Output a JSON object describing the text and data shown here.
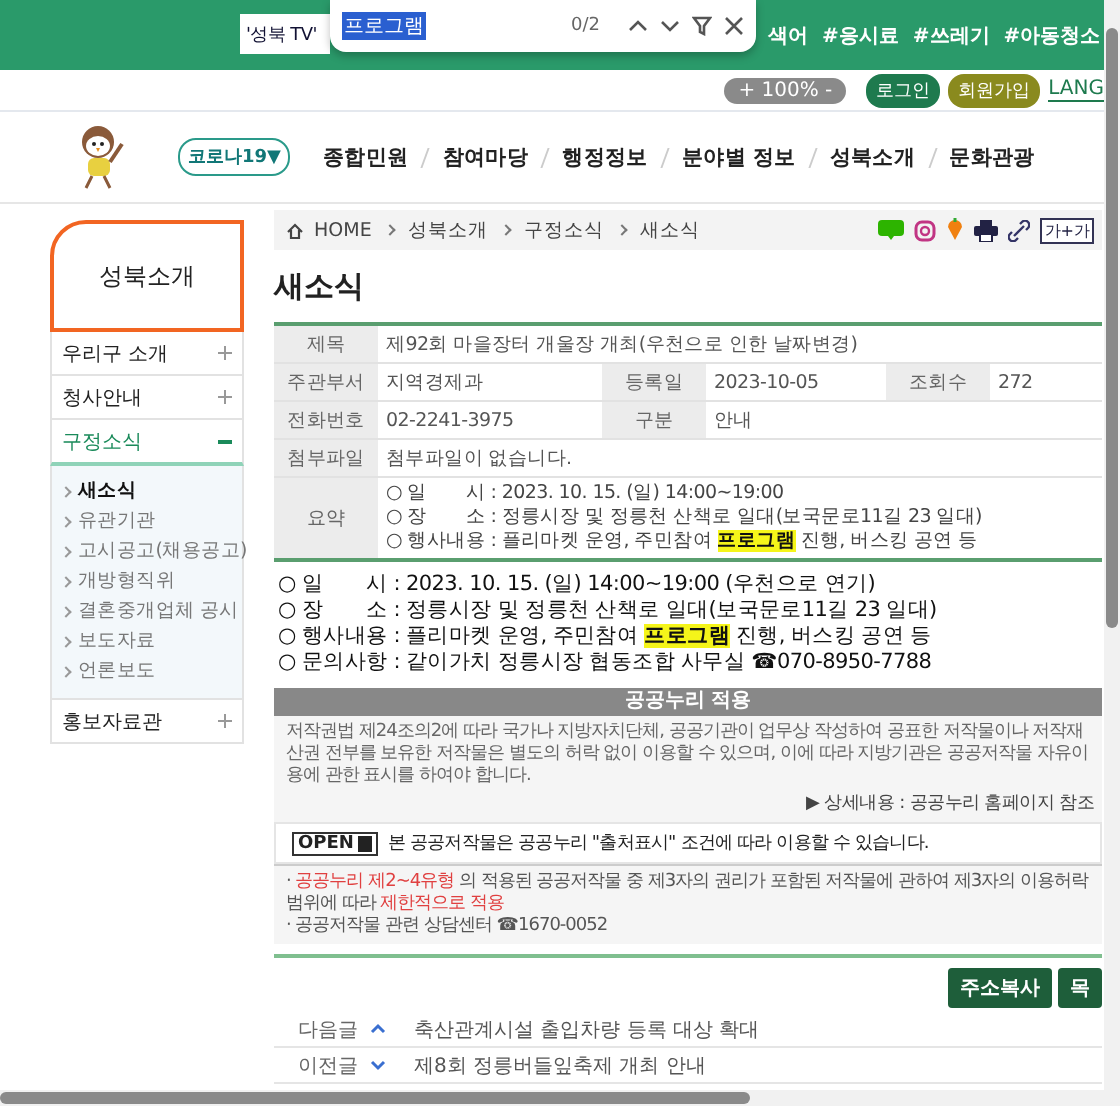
{
  "find_bar": {
    "search_value": "'성북 TV'",
    "find_value": "프로그램",
    "match_count": "0/2"
  },
  "hashtags": [
    "색어",
    "#응시료",
    "#쓰레기",
    "#아동청소"
  ],
  "zoom_control": "+ 100% -",
  "login_button": "로그인",
  "signup_button": "회원가입",
  "language_link": "LANG",
  "covid_button": "코로나19▼",
  "main_menu": [
    "종합민원",
    "참여마당",
    "행정정보",
    "분야별 정보",
    "성북소개",
    "문화관광"
  ],
  "sidebar": {
    "title": "성북소개",
    "items": [
      {
        "label": "우리구 소개",
        "expanded": false
      },
      {
        "label": "청사안내",
        "expanded": false
      },
      {
        "label": "구정소식",
        "expanded": true,
        "children": [
          {
            "label": "새소식",
            "selected": true
          },
          {
            "label": "유관기관",
            "selected": false
          },
          {
            "label": "고시공고(채용공고)",
            "selected": false
          },
          {
            "label": "개방형직위",
            "selected": false
          },
          {
            "label": "결혼중개업체 공시",
            "selected": false
          },
          {
            "label": "보도자료",
            "selected": false
          },
          {
            "label": "언론보도",
            "selected": false
          }
        ]
      },
      {
        "label": "홍보자료관",
        "expanded": false
      }
    ]
  },
  "breadcrumb": [
    "HOME",
    "성북소개",
    "구정소식",
    "새소식"
  ],
  "font_size_button": "가+가",
  "page_title": "새소식",
  "info_table": {
    "rows": [
      [
        {
          "kind": "head",
          "text": "제목"
        },
        {
          "kind": "data",
          "text": "제92회 마을장터 개울장 개최(우천으로 인한 날짜변경)",
          "colspan": 5
        }
      ],
      [
        {
          "kind": "head",
          "text": "주관부서"
        },
        {
          "kind": "data",
          "text": "지역경제과"
        },
        {
          "kind": "head",
          "text": "등록일"
        },
        {
          "kind": "data",
          "text": "2023-10-05"
        },
        {
          "kind": "head",
          "text": "조회수"
        },
        {
          "kind": "data",
          "text": "272"
        }
      ],
      [
        {
          "kind": "head",
          "text": "전화번호"
        },
        {
          "kind": "data",
          "text": "02-2241-3975"
        },
        {
          "kind": "head",
          "text": "구분"
        },
        {
          "kind": "data",
          "text": "안내",
          "colspan": 3
        }
      ],
      [
        {
          "kind": "head",
          "text": "첨부파일"
        },
        {
          "kind": "data",
          "text": "첨부파일이 없습니다.",
          "colspan": 5
        }
      ]
    ]
  },
  "summary": {
    "label": "요약",
    "lines": [
      "○ 일　　시 : 2023. 10. 15. (일) 14:00~19:00",
      "○ 장　　소 : 정릉시장 및 정릉천 산책로 일대(보국문로11길 23 일대)",
      "○ 행사내용 : 플리마켓 운영, 주민참여 **프로그램** 진행, 버스킹 공연 등"
    ]
  },
  "body_lines": [
    "○ 일　　시 : 2023. 10. 15. (일) 14:00~19:00 (우천으로 연기)",
    "○ 장　　소 : 정릉시장 및 정릉천 산책로 일대(보국문로11길 23 일대)",
    "○ 행사내용 : 플리마켓 운영, 주민참여 **프로그램** 진행, 버스킹 공연 등",
    "○ 문의사항 : 같이가치 정릉시장 협동조합 사무실 ☎070-8950-7788"
  ],
  "kogl": {
    "title": "공공누리 적용",
    "description": "저작권법 제24조의2에 따라 국가나 지방자치단체, 공공기관이 업무상 작성하여 공표한 저작물이나 저작재산권 전부를 보유한 저작물은 별도의 허락 없이 이용할 수 있으며, 이에 따라 지방기관은 공공저작물 자유이용에 관한 표시를 하여야 합니다.",
    "detail_link": "▶ 상세내용 : 공공누리 홈페이지 참조",
    "open_badge": "OPEN",
    "license_text": "본 공공저작물은 공공누리 \"출처표시\" 조건에 따라 이용할 수 있습니다.",
    "notices": [
      "· **공공누리 제2~4유형** 의 적용된 공공저작물 중 제3자의 권리가 포함된 저작물에 관하여 제3자의 이용허락 범위에 따라 **제한적으로 적용**",
      "· 공공저작물 관련 상담센터 ☎1670-0052"
    ]
  },
  "buttons": [
    "주소복사",
    "목"
  ],
  "prev_next": [
    {
      "label": "다음글",
      "kind": "next",
      "title": "축산관계시설 출입차량 등록 대상 확대"
    },
    {
      "label": "이전글",
      "kind": "previous",
      "title": "제8회 정릉버들잎축제 개최 안내"
    }
  ]
}
